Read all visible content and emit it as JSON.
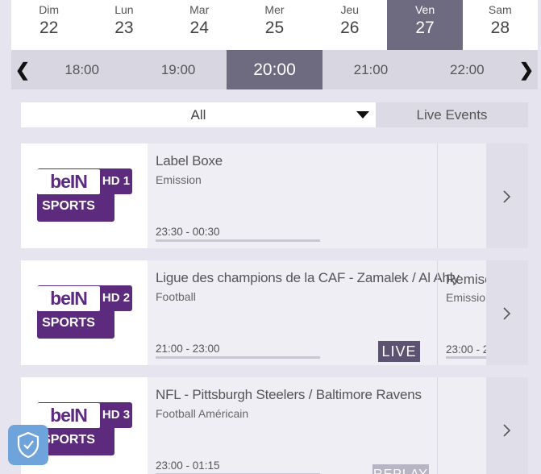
{
  "days": [
    {
      "name": "Dim",
      "date": "22"
    },
    {
      "name": "Lun",
      "date": "23"
    },
    {
      "name": "Mar",
      "date": "24"
    },
    {
      "name": "Mer",
      "date": "25"
    },
    {
      "name": "Jeu",
      "date": "26"
    },
    {
      "name": "Ven",
      "date": "27"
    },
    {
      "name": "Sam",
      "date": "28"
    }
  ],
  "selected_day": "Ven",
  "times": {
    "prev_arrow": "❮",
    "next_arrow": "❯",
    "slots": [
      "18:00",
      "19:00",
      "20:00",
      "21:00",
      "22:00"
    ],
    "selected": "20:00"
  },
  "filter": {
    "dropdown_value": "All",
    "live_events_label": "Live Events"
  },
  "channels": [
    {
      "logo_text": "beIN",
      "logo_sub": "SPORTS",
      "hd_label": "HD 1",
      "program": {
        "title": "Label Boxe",
        "genre": "Emission",
        "time": "23:30 - 00:30",
        "badge": ""
      },
      "next": {
        "title": "",
        "genre": "",
        "time": ""
      }
    },
    {
      "logo_text": "beIN",
      "logo_sub": "SPORTS",
      "hd_label": "HD 2",
      "program": {
        "title": "Ligue des champions de la CAF - Zamalek / Al Ahly",
        "genre": "Football",
        "time": "21:00 - 23:00",
        "badge": "LIVE"
      },
      "next": {
        "title": "Remise",
        "genre": "Emissio",
        "time": "23:00 - 2"
      }
    },
    {
      "logo_text": "beIN",
      "logo_sub": "SPORTS",
      "hd_label": "HD 3",
      "program": {
        "title": "NFL - Pittsburgh Steelers / Baltimore Ravens",
        "genre": "Football Américain",
        "time": "23:00 - 01:15",
        "badge": "REPLAY"
      },
      "next": {
        "title": "",
        "genre": "",
        "time": ""
      }
    }
  ],
  "colors": {
    "accent": "#6e6a7f",
    "brand": "#5c2b7e",
    "live_badge": "#5c5372",
    "replay_badge": "#b7b4c3",
    "shield": "#6ea3dc"
  },
  "icons": {
    "prev": "chevron-left-icon",
    "next": "chevron-right-icon",
    "dropdown": "caret-down-icon",
    "shield": "shield-check-icon"
  }
}
